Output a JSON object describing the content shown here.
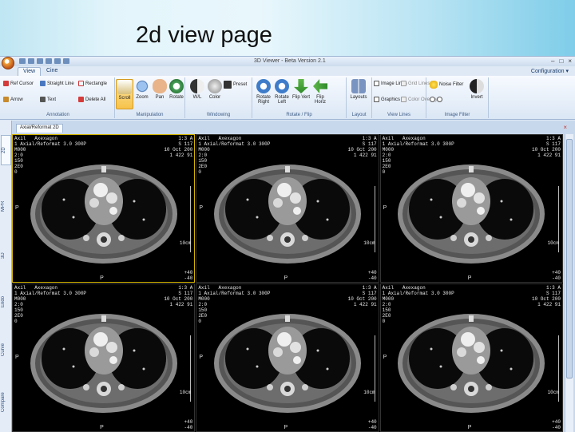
{
  "slide": {
    "title": "2d view page"
  },
  "window": {
    "title": "3D Viewer - Beta Version 2.1",
    "controls": [
      "–",
      "□",
      "×"
    ],
    "configuration_label": "Configuration ▾"
  },
  "tabs": [
    {
      "label": "View",
      "active": true
    },
    {
      "label": "Cine",
      "active": false
    }
  ],
  "ribbon": {
    "annotation": {
      "label": "Annotation",
      "items": [
        "Ref Cursor",
        "Straight Line",
        "Rectangle",
        "Arrow",
        "Text",
        "Delete All"
      ]
    },
    "manipulation": {
      "label": "Manipulation",
      "items": [
        "Scroll",
        "Zoom",
        "Pan",
        "Rotate"
      ],
      "active": "Scroll"
    },
    "windowing": {
      "label": "Windowing",
      "items": [
        "W/L",
        "Color",
        "Preset"
      ]
    },
    "rotate_flip": {
      "label": "Rotate / Flip",
      "items": [
        "Rotate Right",
        "Rotate Left",
        "Flip Vert",
        "Flip Horiz"
      ]
    },
    "layout": {
      "label": "Layout",
      "items": [
        "Layouts"
      ]
    },
    "view_lines": {
      "label": "View Lines",
      "items": [
        "Image Lines",
        "Grid Lines",
        "Graphics",
        "Color Overlay"
      ]
    },
    "image_filter": {
      "label": "Image Filter",
      "items": [
        "Noise Filter",
        "Invert"
      ]
    }
  },
  "side_tabs": [
    "2D",
    "MPR",
    "3D",
    "Endo",
    "Curve",
    "Compare"
  ],
  "document_tab": "Axial/Reformat 2D",
  "viewport_overlay": {
    "top_left": "Axil   Axexagon\n1 Axial/Reformat 3.0 300P\nM000\n2:0\n150\n2E0\n0",
    "top_right": "1:3 A\nS 117\n10 Oct 200\n1 422 91",
    "bottom_right": "+40\n-40",
    "orient_left": "P",
    "orient_bottom": "P",
    "scale": "10cm"
  },
  "viewports": [
    {
      "id": 1,
      "selected": true
    },
    {
      "id": 2,
      "selected": false
    },
    {
      "id": 3,
      "selected": false
    },
    {
      "id": 4,
      "selected": false
    },
    {
      "id": 5,
      "selected": false
    },
    {
      "id": 6,
      "selected": false
    }
  ],
  "colors": {
    "accent": "#f7c24a",
    "ribbon_bg": "#dbe7f5",
    "viewport_bg": "#000000"
  }
}
